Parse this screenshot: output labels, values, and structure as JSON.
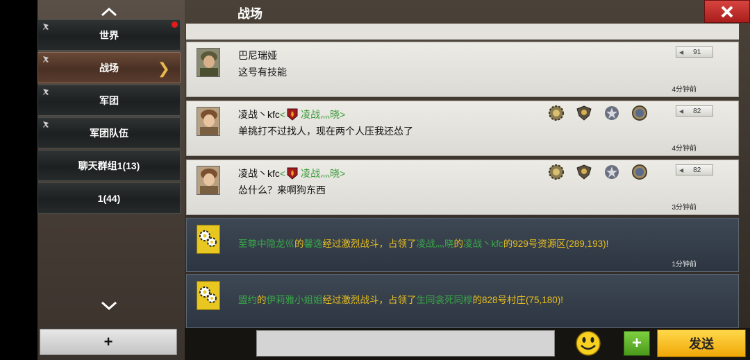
{
  "header": {
    "title": "战场",
    "close_label": "✕"
  },
  "sidebar": {
    "channels": [
      {
        "label": "世界",
        "pinned": true,
        "unread_dot": true
      },
      {
        "label": "战场",
        "pinned": true,
        "active": true
      },
      {
        "label": "军团",
        "pinned": true
      },
      {
        "label": "军团队伍",
        "pinned": true
      },
      {
        "label": "聊天群组1(13)",
        "pinned": false
      },
      {
        "label": "1(44)",
        "pinned": false
      }
    ],
    "add_label": "+",
    "up_icon": "chevron-up-icon",
    "down_icon": "chevron-down-icon"
  },
  "messages": [
    {
      "sender": "巴尼瑞娅",
      "text": "这号有技能",
      "likes": "91",
      "time": "4分钟前"
    },
    {
      "sender": "凌战丶kfc",
      "guild_open": "<",
      "guild": "凌战灬晓",
      "guild_close": ">",
      "text": "单挑打不过找人，现在两个人压我还怂了",
      "likes": "82",
      "time": "4分钟前"
    },
    {
      "sender": "凌战丶kfc",
      "guild_open": "<",
      "guild": "凌战灬晓",
      "guild_close": ">",
      "text": "怂什么？来啊狗东西",
      "likes": "82",
      "time": "3分钟前"
    }
  ],
  "system_messages": [
    {
      "parts": [
        {
          "t": "至尊中隐龙巛",
          "c": "g"
        },
        {
          "t": "的",
          "c": "y"
        },
        {
          "t": "馨逸",
          "c": "g"
        },
        {
          "t": "经过激烈战斗，占领了",
          "c": "y"
        },
        {
          "t": "凌战灬晓",
          "c": "g"
        },
        {
          "t": "的",
          "c": "y"
        },
        {
          "t": "凌战丶kfc",
          "c": "g"
        },
        {
          "t": "的929号资源区(289,193)!",
          "c": "y"
        }
      ],
      "time": "1分钟前"
    },
    {
      "parts": [
        {
          "t": "盟约",
          "c": "g"
        },
        {
          "t": "的",
          "c": "y"
        },
        {
          "t": "伊莉雅小姐姐",
          "c": "g"
        },
        {
          "t": "经过激烈战斗，占领了",
          "c": "y"
        },
        {
          "t": "生同衾死同椁",
          "c": "g"
        },
        {
          "t": "的828号村庄(75,180)!",
          "c": "y"
        }
      ],
      "time": ""
    }
  ],
  "input": {
    "value": "",
    "placeholder": ""
  },
  "buttons": {
    "plus_label": "+",
    "send_label": "发送"
  },
  "colors": {
    "system_yellow": "#e8c020",
    "system_green": "#3aa64a",
    "close_red": "#c8302c",
    "send_yellow": "#f8c020"
  }
}
